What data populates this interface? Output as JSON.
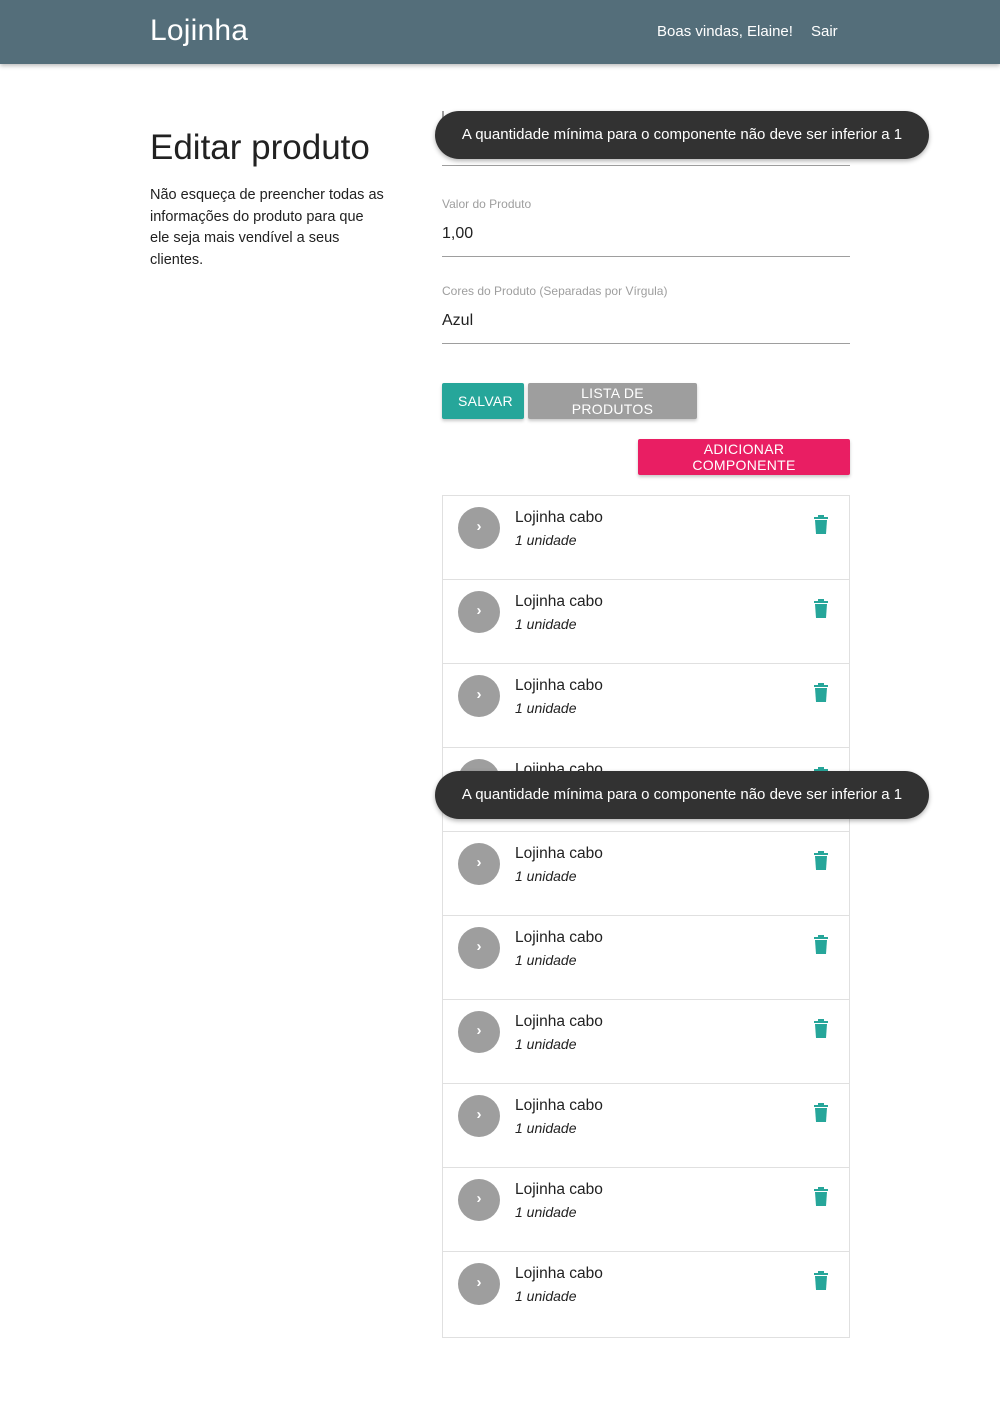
{
  "navbar": {
    "brand": "Lojinha",
    "welcome": "Boas vindas, Elaine!",
    "logout": "Sair",
    "color": "#546e7a"
  },
  "page": {
    "title": "Editar produto",
    "description": "Não esqueça de preencher todas as informações do produto para que ele seja mais vendível a seus clientes."
  },
  "form": {
    "first_field": {
      "label": "",
      "value": ""
    },
    "price": {
      "label": "Valor do Produto",
      "value": "1,00"
    },
    "colors": {
      "label": "Cores do Produto (Separadas por Vírgula)",
      "value": "Azul"
    }
  },
  "buttons": {
    "save": "SALVAR",
    "product_list": "LISTA DE PRODUTOS",
    "add_component": "ADICIONAR COMPONENTE",
    "save_color": "#26a69a",
    "list_color": "#9e9e9e",
    "add_color": "#e91e63"
  },
  "components": [
    {
      "name": "Lojinha cabo",
      "quantity": "1 unidade"
    },
    {
      "name": "Lojinha cabo",
      "quantity": "1 unidade"
    },
    {
      "name": "Lojinha cabo",
      "quantity": "1 unidade"
    },
    {
      "name": "Lojinha cabo",
      "quantity": "1 unidade"
    },
    {
      "name": "Lojinha cabo",
      "quantity": "1 unidade"
    },
    {
      "name": "Lojinha cabo",
      "quantity": "1 unidade"
    },
    {
      "name": "Lojinha cabo",
      "quantity": "1 unidade"
    },
    {
      "name": "Lojinha cabo",
      "quantity": "1 unidade"
    },
    {
      "name": "Lojinha cabo",
      "quantity": "1 unidade"
    },
    {
      "name": "Lojinha cabo",
      "quantity": "1 unidade"
    }
  ],
  "component_icons": {
    "expand": "chevron-right-icon",
    "delete": "trash-icon",
    "delete_color": "#26a69a"
  },
  "toasts": [
    {
      "message": "A quantidade mínima para o componente não deve ser inferior a 1"
    },
    {
      "message": "A quantidade mínima para o componente não deve ser inferior a 1"
    }
  ]
}
